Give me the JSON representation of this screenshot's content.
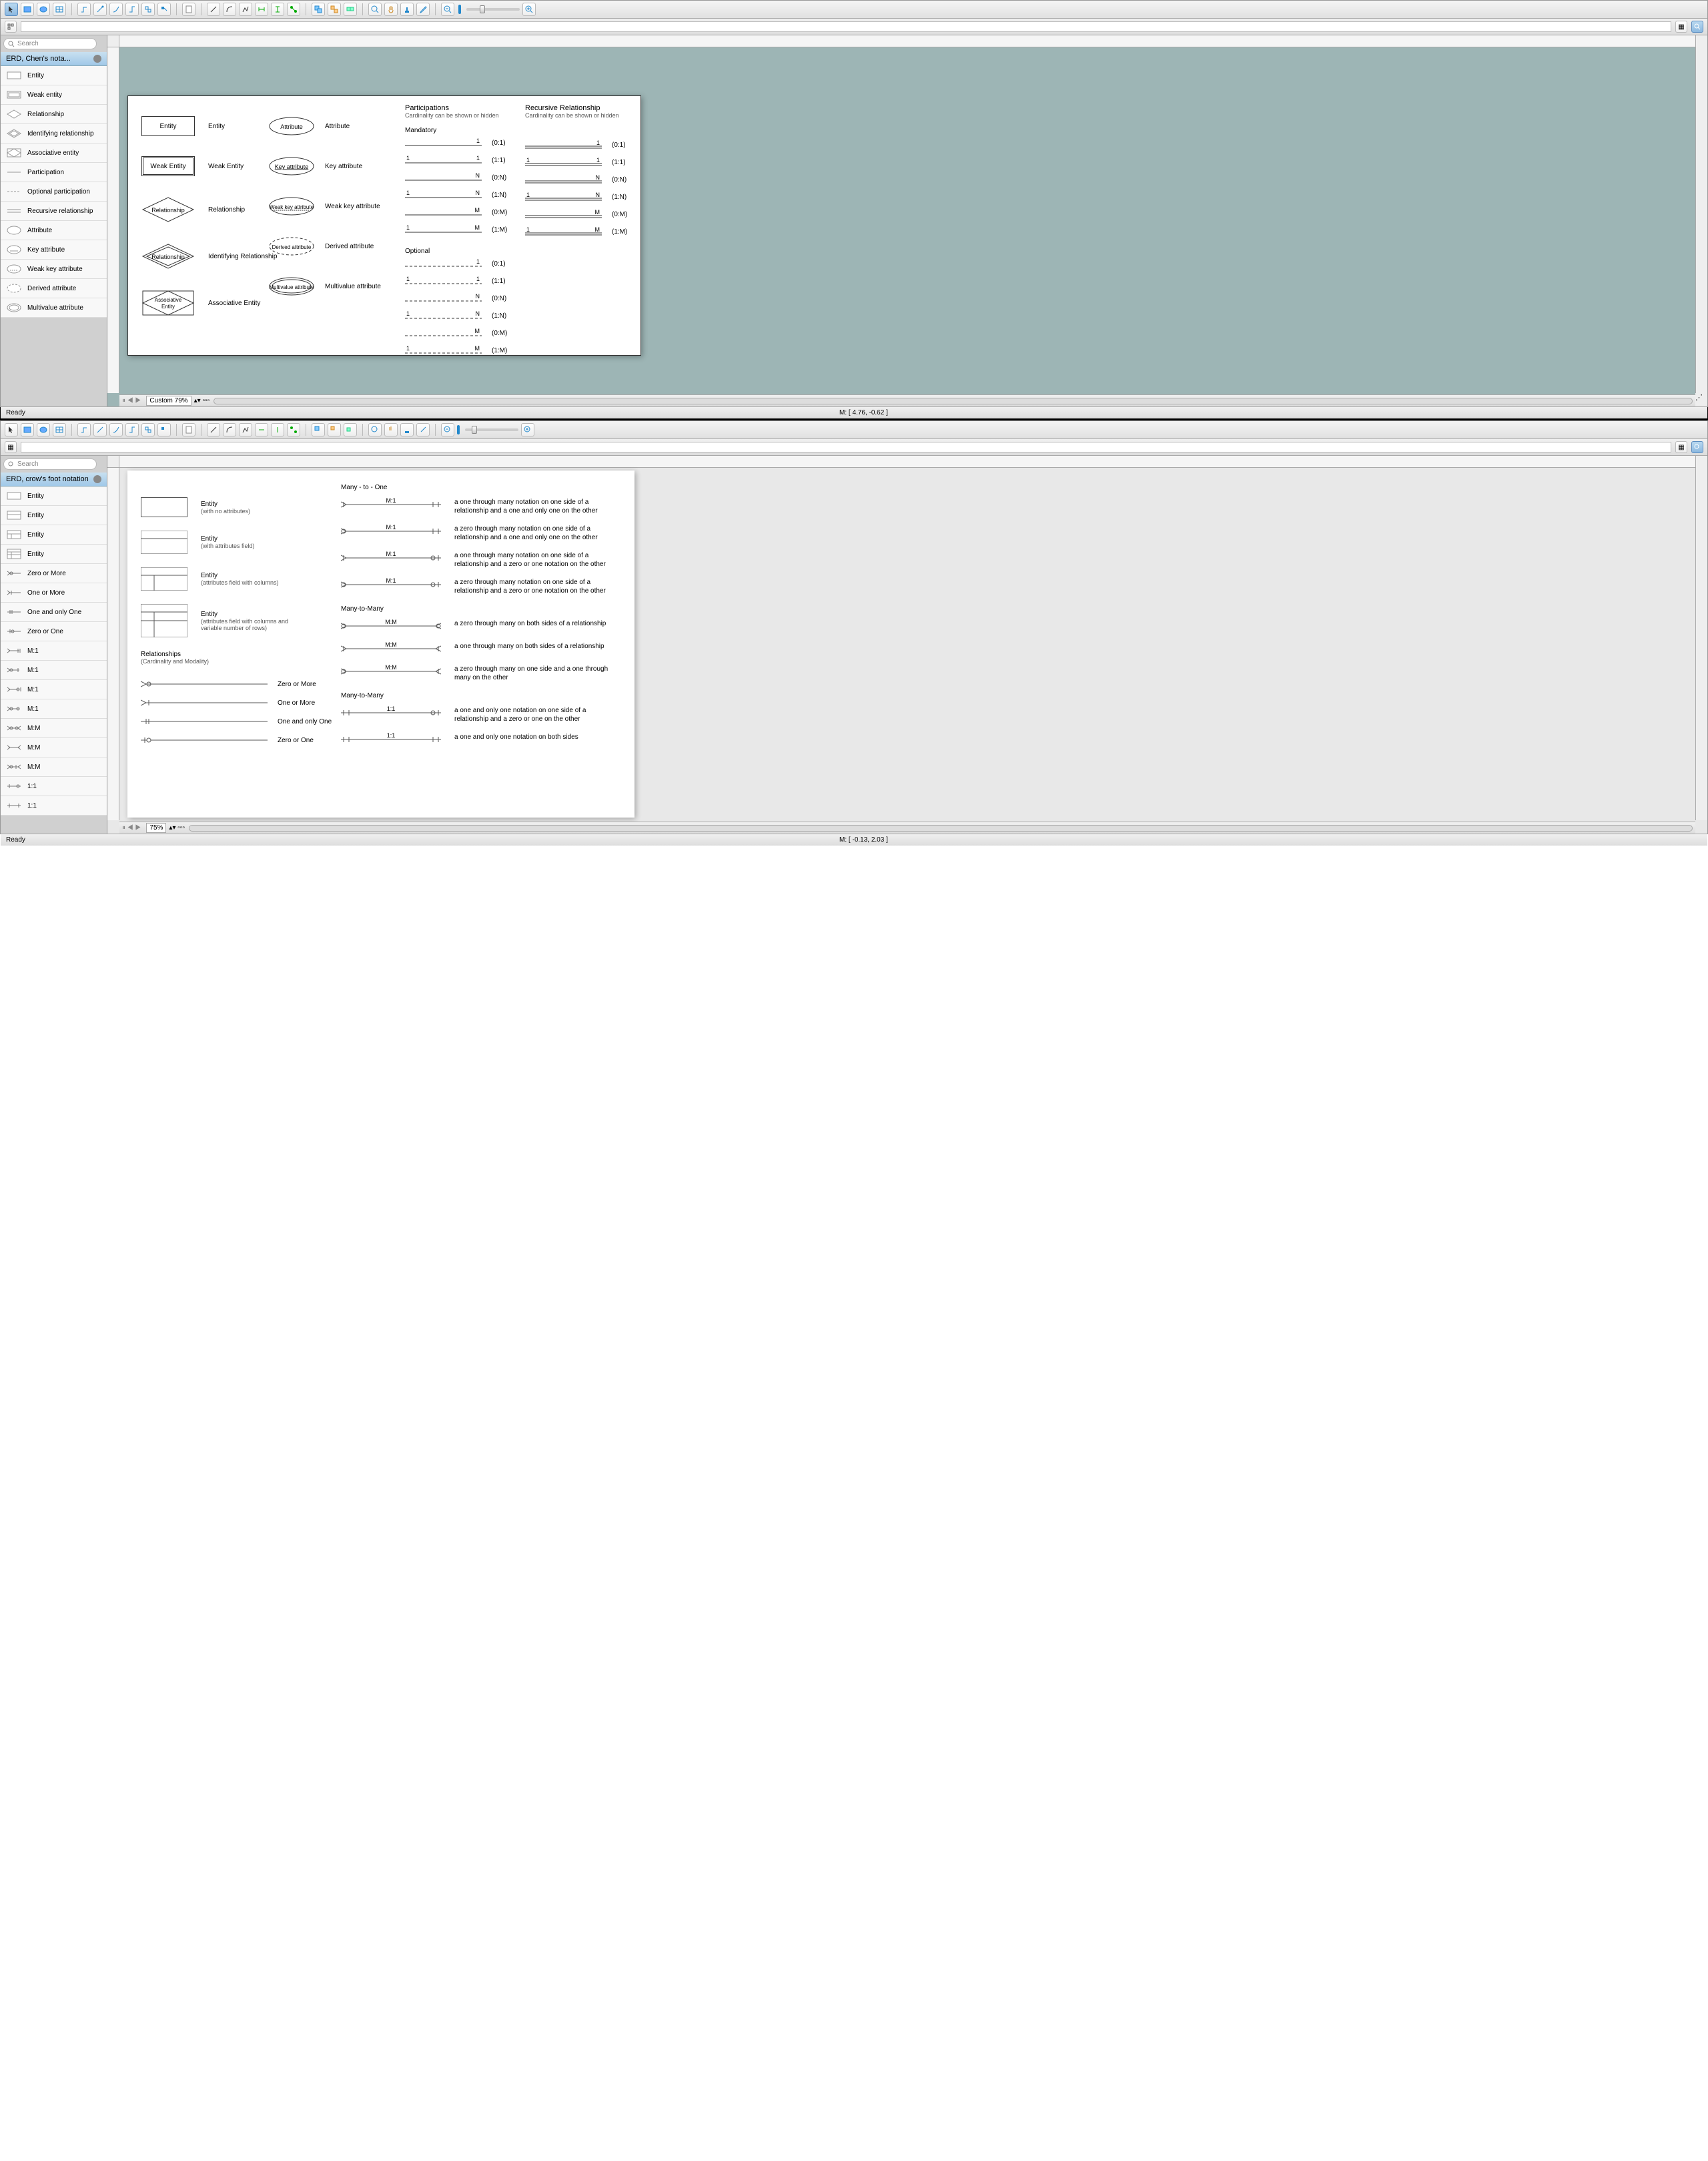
{
  "window1": {
    "search_placeholder": "Search",
    "palette_title": "ERD, Chen's nota...",
    "palette_items": [
      "Entity",
      "Weak entity",
      "Relationship",
      "Identifying relationship",
      "Associative entity",
      "Participation",
      "Optional participation",
      "Recursive relationship",
      "Attribute",
      "Key attribute",
      "Weak key attribute",
      "Derived attribute",
      "Multivalue attribute"
    ],
    "status_ready": "Ready",
    "zoom_label": "Custom 79%",
    "mouse_coords": "M: [ 4.76, -0.62 ]",
    "canvas": {
      "shapes": {
        "entity": {
          "box": "Entity",
          "label": "Entity"
        },
        "weak_entity": {
          "box": "Weak Entity",
          "label": "Weak Entity"
        },
        "relationship": {
          "box": "Relationship",
          "label": "Relationship"
        },
        "identifying": {
          "box": "Relationship",
          "label": "Identifying Relationship"
        },
        "associative": {
          "box": "Associative Entity",
          "label": "Associative Entity"
        },
        "attribute": {
          "box": "Attribute",
          "label": "Attribute"
        },
        "key_attr": {
          "box": "Key attribute",
          "label": "Key attribute"
        },
        "weak_key": {
          "box": "Weak key attribute",
          "label": "Weak key attribute"
        },
        "derived": {
          "box": "Derived attribute",
          "label": "Derived attribute"
        },
        "multivalue": {
          "box": "Multivalue attribute",
          "label": "Multivalue attribute"
        }
      },
      "participations_title": "Participations",
      "participations_sub": "Cardinality can be shown or hidden",
      "recursive_title": "Recursive Relationship",
      "recursive_sub": "Cardinality can be shown or hidden",
      "mandatory_title": "Mandatory",
      "optional_title": "Optional",
      "mandatory_rows": [
        {
          "left": "",
          "right": "1",
          "card": "(0:1)"
        },
        {
          "left": "1",
          "right": "1",
          "card": "(1:1)"
        },
        {
          "left": "",
          "right": "N",
          "card": "(0:N)"
        },
        {
          "left": "1",
          "right": "N",
          "card": "(1:N)"
        },
        {
          "left": "",
          "right": "M",
          "card": "(0:M)"
        },
        {
          "left": "1",
          "right": "M",
          "card": "(1:M)"
        }
      ],
      "optional_rows": [
        {
          "left": "",
          "right": "1",
          "card": "(0:1)"
        },
        {
          "left": "1",
          "right": "1",
          "card": "(1:1)"
        },
        {
          "left": "",
          "right": "N",
          "card": "(0:N)"
        },
        {
          "left": "1",
          "right": "N",
          "card": "(1:N)"
        },
        {
          "left": "",
          "right": "M",
          "card": "(0:M)"
        },
        {
          "left": "1",
          "right": "M",
          "card": "(1:M)"
        }
      ]
    }
  },
  "window2": {
    "search_placeholder": "Search",
    "palette_title": "ERD, crow's foot notation",
    "palette_items": [
      "Entity",
      "Entity",
      "Entity",
      "Entity",
      "Zero or More",
      "One or More",
      "One and only One",
      "Zero or One",
      "M:1",
      "M:1",
      "M:1",
      "M:1",
      "M:M",
      "M:M",
      "M:M",
      "1:1",
      "1:1"
    ],
    "status_ready": "Ready",
    "zoom_label": "75%",
    "mouse_coords": "M: [ -0.13, 2.03 ]",
    "canvas": {
      "entities": [
        {
          "title": "Entity",
          "sub": "(with no attributes)"
        },
        {
          "title": "Entity",
          "sub": "(with attributes field)"
        },
        {
          "title": "Entity",
          "sub": "(attributes field with columns)"
        },
        {
          "title": "Entity",
          "sub": "(attributes field with columns and variable number of rows)"
        }
      ],
      "rel_header": "Relationships",
      "rel_sub": "(Cardinality and Modality)",
      "basic_rels": [
        "Zero or More",
        "One or More",
        "One and only One",
        "Zero or One"
      ],
      "m1_title": "Many - to - One",
      "m1_rows": [
        {
          "label": "M:1",
          "desc": "a one through many notation on one side of a relationship and a one and only one on the other"
        },
        {
          "label": "M:1",
          "desc": "a zero through many notation on one side of a relationship and a one and only one on the other"
        },
        {
          "label": "M:1",
          "desc": "a one through many notation on one side of a relationship and a zero or one notation on the other"
        },
        {
          "label": "M:1",
          "desc": "a zero through many notation on one side of a relationship and a zero or one notation on the other"
        }
      ],
      "mm_title": "Many-to-Many",
      "mm_rows": [
        {
          "label": "M:M",
          "desc": "a zero through many on both sides of a relationship"
        },
        {
          "label": "M:M",
          "desc": "a one through many on both sides of a relationship"
        },
        {
          "label": "M:M",
          "desc": "a zero through many on one side and a one through many on the other"
        }
      ],
      "oo_title": "Many-to-Many",
      "oo_rows": [
        {
          "label": "1:1",
          "desc": "a one and only one notation on one side of a relationship and a zero or one on the other"
        },
        {
          "label": "1:1",
          "desc": "a one and only one notation on both sides"
        }
      ]
    }
  }
}
